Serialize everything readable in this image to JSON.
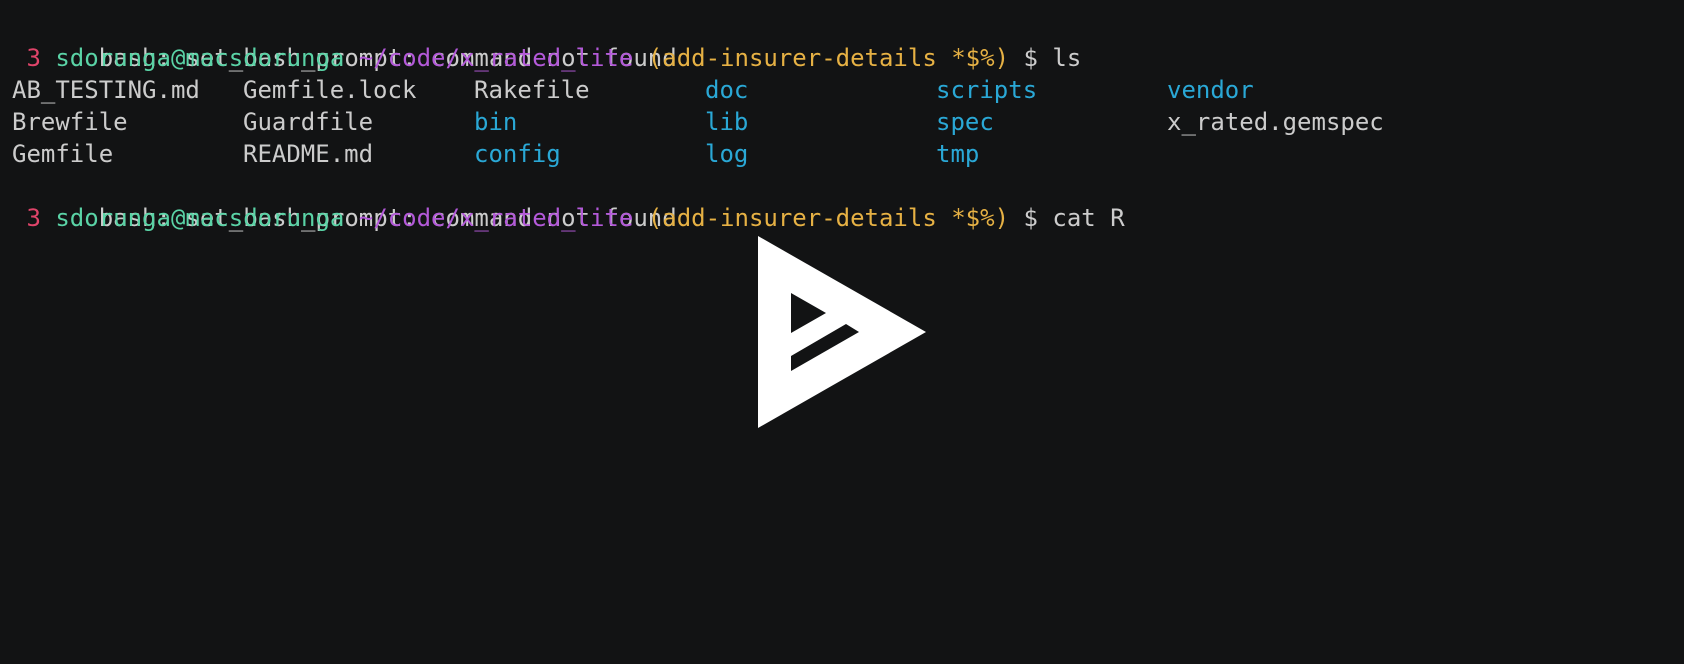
{
  "terminal": {
    "background": "#121314",
    "colors": {
      "number": "#e0446a",
      "user": "#5ad3a6",
      "path": "#b359d9",
      "branch": "#e6b144",
      "text": "#cccccc",
      "directory": "#2aa8d6"
    },
    "error_line_1": "bash: set_bash_prompt: command not found",
    "prompt_1": {
      "number": " 3",
      "user_host": "sdorunga@macsdorunga",
      "path": "~/code/x_rated_lite",
      "branch": "(add-insurer-details *$%)",
      "symbol": "$",
      "command": "ls"
    },
    "ls_output": [
      [
        {
          "name": "AB_TESTING.md",
          "type": "file"
        },
        {
          "name": "Gemfile.lock",
          "type": "file"
        },
        {
          "name": "Rakefile",
          "type": "file"
        },
        {
          "name": "doc",
          "type": "dir"
        },
        {
          "name": "scripts",
          "type": "dir"
        },
        {
          "name": "vendor",
          "type": "dir"
        }
      ],
      [
        {
          "name": "Brewfile",
          "type": "file"
        },
        {
          "name": "Guardfile",
          "type": "file"
        },
        {
          "name": "bin",
          "type": "dir"
        },
        {
          "name": "lib",
          "type": "dir"
        },
        {
          "name": "spec",
          "type": "dir"
        },
        {
          "name": "x_rated.gemspec",
          "type": "file"
        }
      ],
      [
        {
          "name": "Gemfile",
          "type": "file"
        },
        {
          "name": "README.md",
          "type": "file"
        },
        {
          "name": "config",
          "type": "dir"
        },
        {
          "name": "log",
          "type": "dir"
        },
        {
          "name": "tmp",
          "type": "dir"
        }
      ]
    ],
    "error_line_2": "bash: set_bash_prompt: command not found",
    "prompt_2": {
      "number": " 3",
      "user_host": "sdorunga@macsdorunga",
      "path": "~/code/x_rated_lite",
      "branch": "(add-insurer-details *$%)",
      "symbol": "$",
      "command": "cat R"
    }
  },
  "player": {
    "play_icon": "asciinema-play-icon",
    "icon_color": "#ffffff"
  }
}
